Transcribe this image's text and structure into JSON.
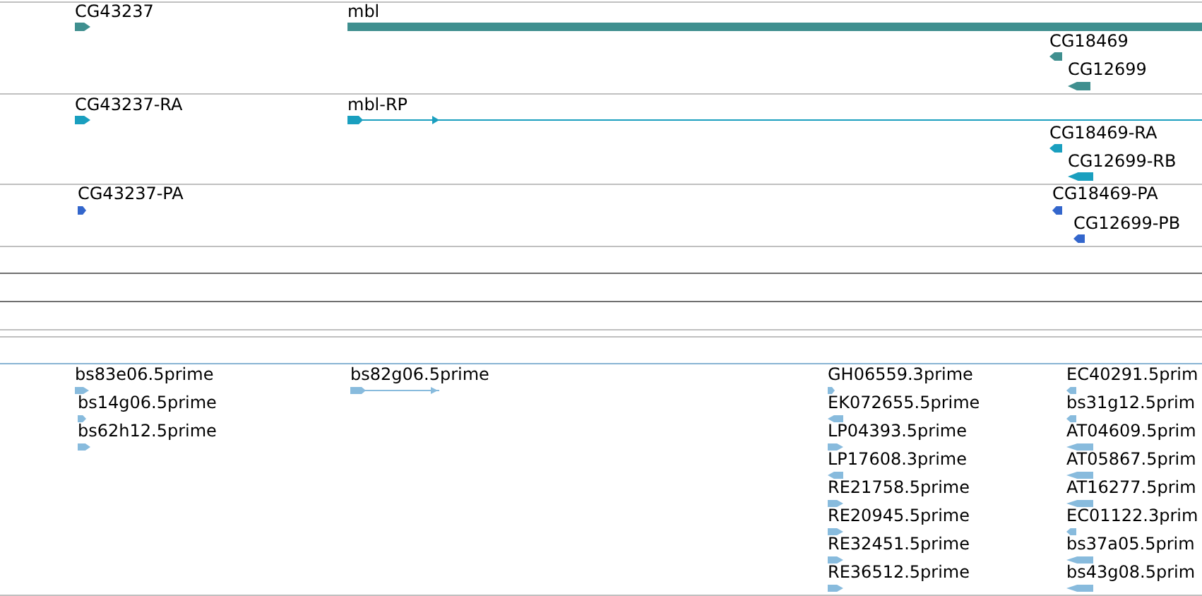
{
  "tracks": [
    {
      "color": "#3f8f8f",
      "features": [
        {
          "label": "CG43237",
          "reverse": false
        },
        {
          "label": "mbl",
          "reverse": false
        },
        {
          "label": "CG18469",
          "reverse": true
        },
        {
          "label": "CG12699",
          "reverse": true
        }
      ]
    },
    {
      "color": "#1a9fbf",
      "features": [
        {
          "label": "CG43237-RA",
          "reverse": false
        },
        {
          "label": "mbl-RP",
          "reverse": false
        },
        {
          "label": "CG18469-RA",
          "reverse": true
        },
        {
          "label": "CG12699-RB",
          "reverse": true
        }
      ]
    },
    {
      "color": "#3366cc",
      "features": [
        {
          "label": "CG43237-PA",
          "reverse": false
        },
        {
          "label": "CG18469-PA",
          "reverse": true
        },
        {
          "label": "CG12699-PB",
          "reverse": true
        }
      ]
    },
    {
      "color": "#88bbdd",
      "features": [
        {
          "label": "bs83e06.5prime",
          "reverse": false
        },
        {
          "label": "bs14g06.5prime",
          "reverse": false
        },
        {
          "label": "bs62h12.5prime",
          "reverse": false
        },
        {
          "label": "bs82g06.5prime",
          "reverse": false
        },
        {
          "label": "GH06559.3prime",
          "reverse": false
        },
        {
          "label": "EK072655.5prime",
          "reverse": true
        },
        {
          "label": "LP04393.5prime",
          "reverse": false
        },
        {
          "label": "LP17608.3prime",
          "reverse": true
        },
        {
          "label": "RE21758.5prime",
          "reverse": false
        },
        {
          "label": "RE20945.5prime",
          "reverse": false
        },
        {
          "label": "RE32451.5prime",
          "reverse": false
        },
        {
          "label": "RE36512.5prime",
          "reverse": false
        },
        {
          "label": "EC40291.5prim",
          "reverse": true
        },
        {
          "label": "bs31g12.5prim",
          "reverse": true
        },
        {
          "label": "AT04609.5prim",
          "reverse": true
        },
        {
          "label": "AT05867.5prim",
          "reverse": true
        },
        {
          "label": "AT16277.5prim",
          "reverse": true
        },
        {
          "label": "EC01122.3prim",
          "reverse": true
        },
        {
          "label": "bs37a05.5prim",
          "reverse": true
        },
        {
          "label": "bs43g08.5prim",
          "reverse": true
        }
      ]
    }
  ]
}
